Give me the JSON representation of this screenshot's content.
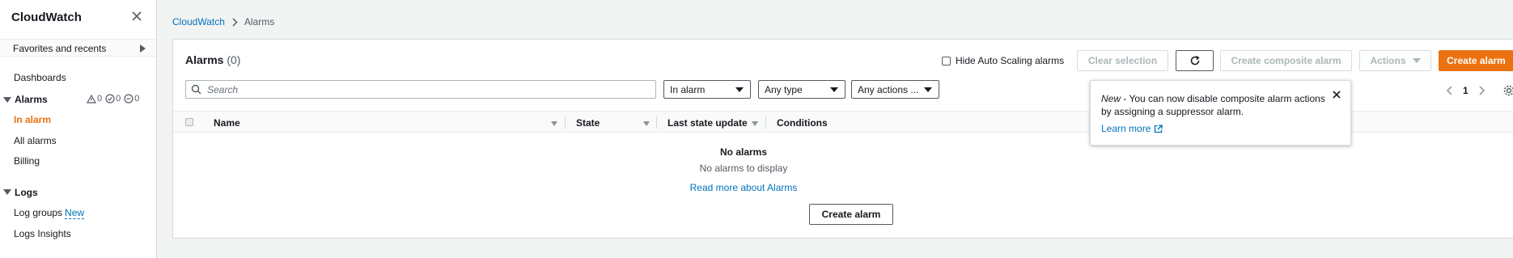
{
  "sidebar": {
    "title": "CloudWatch",
    "favorites": "Favorites and recents",
    "dashboards": "Dashboards",
    "alarms": {
      "label": "Alarms",
      "counts": {
        "alarm": "0",
        "ok": "0",
        "insufficient": "0"
      },
      "items": [
        "In alarm",
        "All alarms",
        "Billing"
      ]
    },
    "logs": {
      "label": "Logs",
      "log_groups": "Log groups",
      "new_badge": "New",
      "logs_insights": "Logs Insights"
    }
  },
  "breadcrumb": {
    "root": "CloudWatch",
    "current": "Alarms"
  },
  "panel": {
    "title": "Alarms",
    "count": "(0)",
    "hide_autoscaling": "Hide Auto Scaling alarms",
    "clear_selection": "Clear selection",
    "create_composite": "Create composite alarm",
    "actions": "Actions",
    "create_alarm": "Create alarm",
    "search_placeholder": "Search",
    "filters": {
      "state": "In alarm",
      "type": "Any type",
      "actions": "Any actions ..."
    },
    "page": "1"
  },
  "table": {
    "columns": [
      "Name",
      "State",
      "Last state update",
      "Conditions"
    ],
    "empty_title": "No alarms",
    "empty_desc": "No alarms to display",
    "read_more": "Read more about Alarms",
    "create_alarm": "Create alarm"
  },
  "popover": {
    "new_label": "New",
    "text": " - You can now disable composite alarm actions by assigning a suppressor alarm.",
    "learn_more": "Learn more"
  },
  "colors": {
    "accent": "#ec7211",
    "link": "#0073bb",
    "border": "#d5dbdb"
  },
  "icons": [
    "close-icon",
    "chevron-right-icon",
    "alarm-warning-icon",
    "ok-check-icon",
    "insufficient-data-icon",
    "refresh-icon",
    "search-icon",
    "sort-icon",
    "external-link-icon",
    "settings-icon"
  ]
}
